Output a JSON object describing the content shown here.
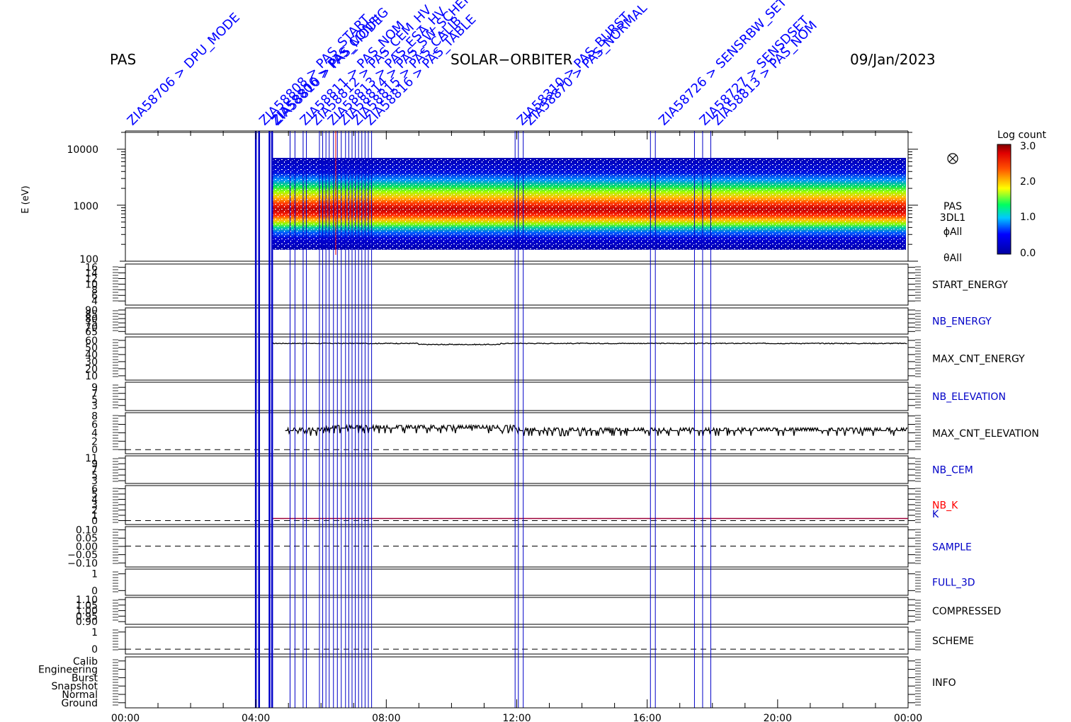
{
  "header": {
    "instrument": "PAS",
    "mission": "SOLAR−ORBITER",
    "date": "09/Jan/2023"
  },
  "colors": {
    "axis": "#000000",
    "event_line": "#0000c8",
    "event_text": "#0000ff",
    "red_marker": "#ff0000",
    "k_line": "#9b0038"
  },
  "event_labels": [
    {
      "text": "ZIA58706 > DPU_MODE",
      "time": 0.0
    },
    {
      "text": "ZIA58808 > PAS_START",
      "time": 4.05
    },
    {
      "text": "ZIA58806 > PAS_CONFIG",
      "time": 4.4
    },
    {
      "text": "ZIA58810 > PAS_MODE",
      "time": 4.45
    },
    {
      "text": "ZIA58811 > PAS_NOM",
      "time": 5.3
    },
    {
      "text": "ZIA58812 > PAS_CEM_HV",
      "time": 5.65
    },
    {
      "text": "ZIA58813 > PAS_ESA_HV",
      "time": 6.15
    },
    {
      "text": "ZIA58814 > PAS_SW_SCHEME",
      "time": 6.5
    },
    {
      "text": "ZIA58815 > PAS_CALIB",
      "time": 6.9
    },
    {
      "text": "ZIA58816 > PAS_TABLE",
      "time": 7.3
    },
    {
      "text": "ZIA58310 > PAS_BURST",
      "time": 11.95
    },
    {
      "text": "ZIA58870 > PAS_NORMAL",
      "time": 12.2
    },
    {
      "text": "ZIA58726 > SENSRBW_SET",
      "time": 16.3
    },
    {
      "text": "ZIA58727 > SENSDSET",
      "time": 17.55
    },
    {
      "text": "ZIA58813 > PAS_NOM",
      "time": 17.95
    }
  ],
  "chart_data": {
    "type": "heatmap",
    "title": "",
    "x_range_hours": [
      0,
      24
    ],
    "x_ticks": [
      "00:00",
      "04:00",
      "08:00",
      "12:00",
      "16:00",
      "20:00",
      "00:00"
    ],
    "colorbar": {
      "title": "Log count",
      "range": [
        0.0,
        3.0
      ],
      "ticks": [
        "3.0",
        "2.0",
        "1.0",
        "0.0"
      ]
    },
    "spectrogram": {
      "ylabel": "E (eV)",
      "ylim": [
        100,
        20000
      ],
      "y_ticks": [
        "10000",
        "1000",
        "100"
      ],
      "labels": [
        "PAS",
        "3DL1",
        "ϕAll",
        "θAll"
      ],
      "data_start_hour": 4.5,
      "energy_range": [
        160,
        7000
      ],
      "peak_energy": 750
    },
    "panels": [
      {
        "label": "START_ENERGY",
        "label_color": "#000000",
        "y_ticks": [
          "16",
          "14",
          "12",
          "10",
          "8",
          "6",
          "4"
        ]
      },
      {
        "label": "NB_ENERGY",
        "label_color": "#0000c8",
        "y_ticks": [
          "90",
          "85",
          "80",
          "75",
          "70",
          "65"
        ]
      },
      {
        "label": "MAX_CNT_ENERGY",
        "label_color": "#000000",
        "y_ticks": [
          "60",
          "50",
          "40",
          "30",
          "20",
          "10"
        ],
        "ylim": [
          5,
          65
        ],
        "trace_value": 56
      },
      {
        "label": "NB_ELEVATION",
        "label_color": "#0000c8",
        "y_ticks": [
          "9",
          "7",
          "5",
          "3"
        ]
      },
      {
        "label": "MAX_CNT_ELEVATION",
        "label_color": "#000000",
        "y_ticks": [
          "8",
          "6",
          "4",
          "2",
          "0"
        ],
        "ylim": [
          0,
          8
        ],
        "trace_value": 4.5
      },
      {
        "label": "NB_CEM",
        "label_color": "#0000c8",
        "y_ticks": [
          "11",
          "9",
          "7",
          "5",
          "3"
        ]
      },
      {
        "label": "NB_K",
        "label_color": "#ff0000",
        "label2": "K",
        "label2_color": "#0000c8",
        "y_ticks": [
          "6",
          "5",
          "4",
          "3",
          "2",
          "1",
          "0"
        ],
        "ylim": [
          0,
          6.5
        ],
        "trace_value": 1
      },
      {
        "label": "SAMPLE",
        "label_color": "#0000c8",
        "y_ticks": [
          "0.10",
          "0.05",
          "0.00",
          "−0.05",
          "−0.10"
        ]
      },
      {
        "label": "FULL_3D",
        "label_color": "#0000c8",
        "y_ticks": [
          "1",
          "0"
        ]
      },
      {
        "label": "COMPRESSED",
        "label_color": "#000000",
        "y_ticks": [
          "1.10",
          "1.05",
          "1.00",
          "0.95",
          "0.90"
        ]
      },
      {
        "label": "SCHEME",
        "label_color": "#000000",
        "y_ticks": [
          "1",
          "0"
        ]
      },
      {
        "label": "INFO",
        "label_color": "#000000",
        "y_ticks": [
          "Calib",
          "Engineering",
          "Burst",
          "Snapshot",
          "Normal",
          "Ground"
        ]
      }
    ],
    "event_times_hours": [
      4.0,
      4.1,
      4.42,
      4.5,
      5.05,
      5.2,
      5.45,
      5.55,
      5.95,
      6.05,
      6.15,
      6.25,
      6.38,
      6.5,
      6.62,
      6.75,
      6.85,
      6.95,
      7.05,
      7.15,
      7.25,
      7.35,
      7.45,
      7.55,
      11.95,
      12.05,
      12.2,
      16.1,
      16.25,
      17.45,
      17.7,
      17.95
    ],
    "red_marker_hours": [
      6.45
    ]
  }
}
